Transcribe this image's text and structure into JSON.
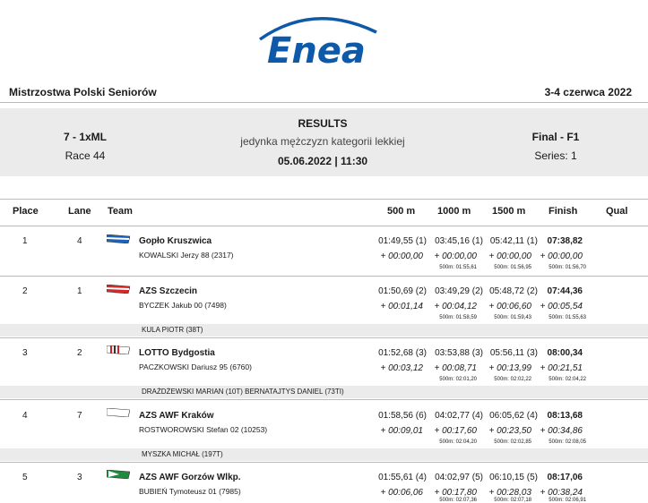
{
  "logo": {
    "text": "Enea"
  },
  "event": {
    "name": "Mistrzostwa Polski Seniorów",
    "dates": "3-4 czerwca 2022"
  },
  "race": {
    "code": "7 - 1xML",
    "race_no": "Race 44",
    "results_label": "RESULTS",
    "description": "jedynka mężczyzn kategorii lekkiej",
    "datetime": "05.06.2022 | 11:30",
    "phase": "Final - F1",
    "series": "Series: 1"
  },
  "columns": {
    "place": "Place",
    "lane": "Lane",
    "team": "Team",
    "m500": "500 m",
    "m1000": "1000 m",
    "m1500": "1500 m",
    "finish": "Finish",
    "qual": "Qual"
  },
  "rows": [
    {
      "place": "1",
      "lane": "4",
      "club": "Gopło Kruszwica",
      "crew": "KOWALSKI  Jerzy 88 (2317)",
      "t500": "01:49,55 (1)",
      "d500": "+ 00:00,00",
      "t1000": "03:45,16 (1)",
      "d1000": "+ 00:00,00",
      "s1000": "500m: 01:55,61",
      "t1500": "05:42,11 (1)",
      "d1500": "+ 00:00,00",
      "s1500": "500m: 01:56,95",
      "fin": "07:38,82",
      "dfin": "+ 00:00,00",
      "sfin": "500m: 01:56,70",
      "coach": ""
    },
    {
      "place": "2",
      "lane": "1",
      "club": "AZS Szczecin",
      "crew": "BYCZEK  Jakub 00 (7498)",
      "t500": "01:50,69 (2)",
      "d500": "+ 00:01,14",
      "t1000": "03:49,29 (2)",
      "d1000": "+ 00:04,12",
      "s1000": "500m: 01:58,59",
      "t1500": "05:48,72 (2)",
      "d1500": "+ 00:06,60",
      "s1500": "500m: 01:59,43",
      "fin": "07:44,36",
      "dfin": "+ 00:05,54",
      "sfin": "500m: 01:55,63",
      "coach": "KULA PIOTR (38T)"
    },
    {
      "place": "3",
      "lane": "2",
      "club": "LOTTO Bydgostia",
      "crew": "PACZKOWSKI  Dariusz 95 (6760)",
      "t500": "01:52,68 (3)",
      "d500": "+ 00:03,12",
      "t1000": "03:53,88 (3)",
      "d1000": "+ 00:08,71",
      "s1000": "500m: 02:01,20",
      "t1500": "05:56,11 (3)",
      "d1500": "+ 00:13,99",
      "s1500": "500m: 02:02,22",
      "fin": "08:00,34",
      "dfin": "+ 00:21,51",
      "sfin": "500m: 02:04,22",
      "coach": "DRAŻDŻEWSKI MARIAN (10T) BERNATAJTYS DANIEL (73TI)"
    },
    {
      "place": "4",
      "lane": "7",
      "club": "AZS AWF Kraków",
      "crew": "ROSTWOROWSKI  Stefan 02 (10253)",
      "t500": "01:58,56 (6)",
      "d500": "+ 00:09,01",
      "t1000": "04:02,77 (4)",
      "d1000": "+ 00:17,60",
      "s1000": "500m: 02:04,20",
      "t1500": "06:05,62 (4)",
      "d1500": "+ 00:23,50",
      "s1500": "500m: 02:02,85",
      "fin": "08:13,68",
      "dfin": "+ 00:34,86",
      "sfin": "500m: 02:08,05",
      "coach": "MYSZKA MICHAŁ (197T)"
    },
    {
      "place": "5",
      "lane": "3",
      "club": "AZS AWF Gorzów Wlkp.",
      "crew": "BUBIEŃ  Tymoteusz 01 (7985)",
      "t500": "01:55,61 (4)",
      "d500": "+ 00:06,06",
      "t1000": "04:02,97 (5)",
      "d1000": "+ 00:17,80",
      "s1000": "500m: 02:07,36",
      "t1500": "06:10,15 (5)",
      "d1500": "+ 00:28,03",
      "s1500": "500m: 02:07,18",
      "fin": "08:17,06",
      "dfin": "+ 00:38,24",
      "sfin": "500m: 02:06,91",
      "coach": ""
    }
  ],
  "colors": {
    "brand_blue": "#0f5aa8",
    "band": "#ebebeb"
  },
  "flag_icons": [
    "blue-white-flag-icon",
    "red-white-flag-icon",
    "striped-flag-icon",
    "white-flag-icon",
    "green-flag-icon"
  ]
}
